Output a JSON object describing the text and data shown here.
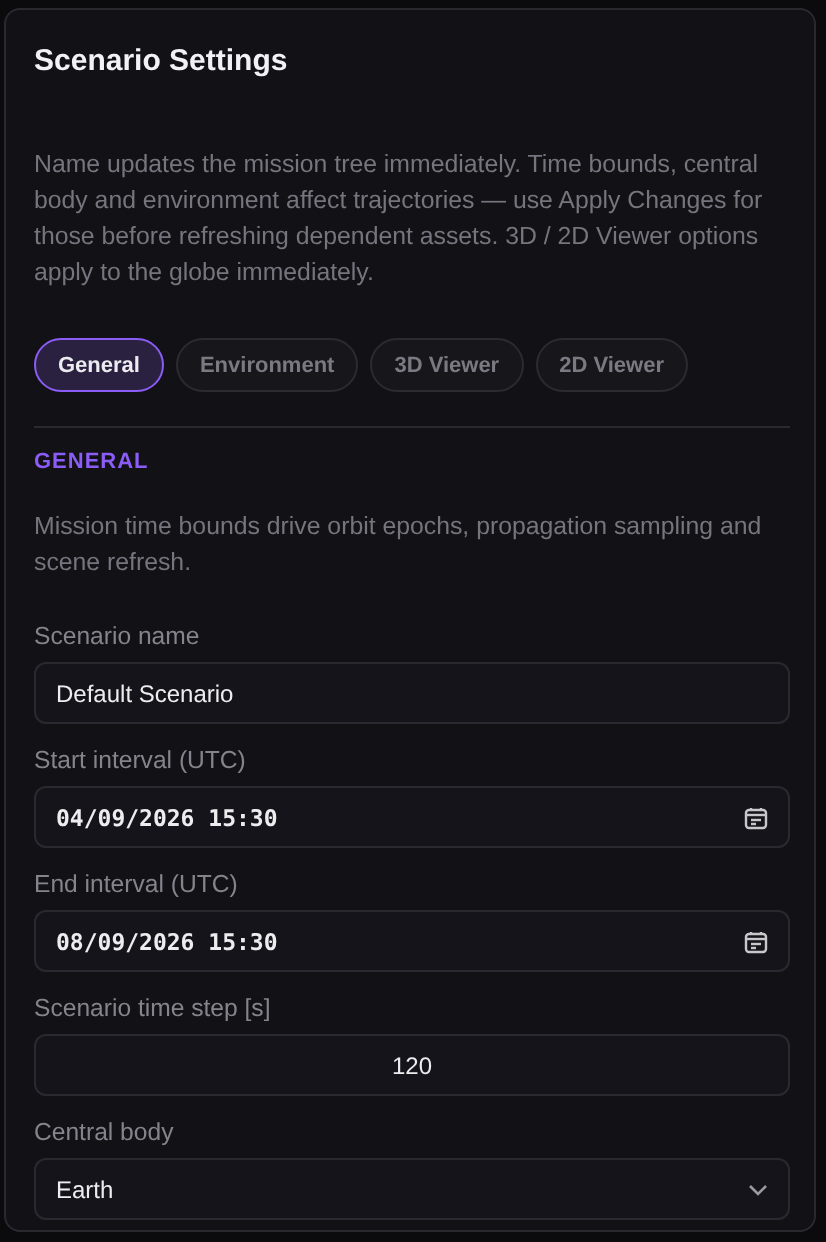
{
  "panel": {
    "title": "Scenario Settings",
    "description": "Name updates the mission tree immediately. Time bounds, central body and environment affect trajectories — use Apply Changes for those before refreshing dependent assets. 3D / 2D Viewer options apply to the globe immediately."
  },
  "tabs": [
    {
      "label": "General",
      "selected": true
    },
    {
      "label": "Environment",
      "selected": false
    },
    {
      "label": "3D Viewer",
      "selected": false
    },
    {
      "label": "2D Viewer",
      "selected": false
    }
  ],
  "section": {
    "heading": "GENERAL",
    "description": "Mission time bounds drive orbit epochs, propagation sampling and scene refresh."
  },
  "fields": [
    {
      "kind": "text",
      "label": "Scenario name",
      "value": "Default Scenario"
    },
    {
      "kind": "datetime",
      "label": "Start interval (UTC)",
      "value": "04/09/2026 15:30"
    },
    {
      "kind": "datetime",
      "label": "End interval (UTC)",
      "value": "08/09/2026 15:30"
    },
    {
      "kind": "number",
      "label": "Scenario time step [s]",
      "value": "120"
    },
    {
      "kind": "select",
      "label": "Central body",
      "value": "Earth"
    }
  ]
}
